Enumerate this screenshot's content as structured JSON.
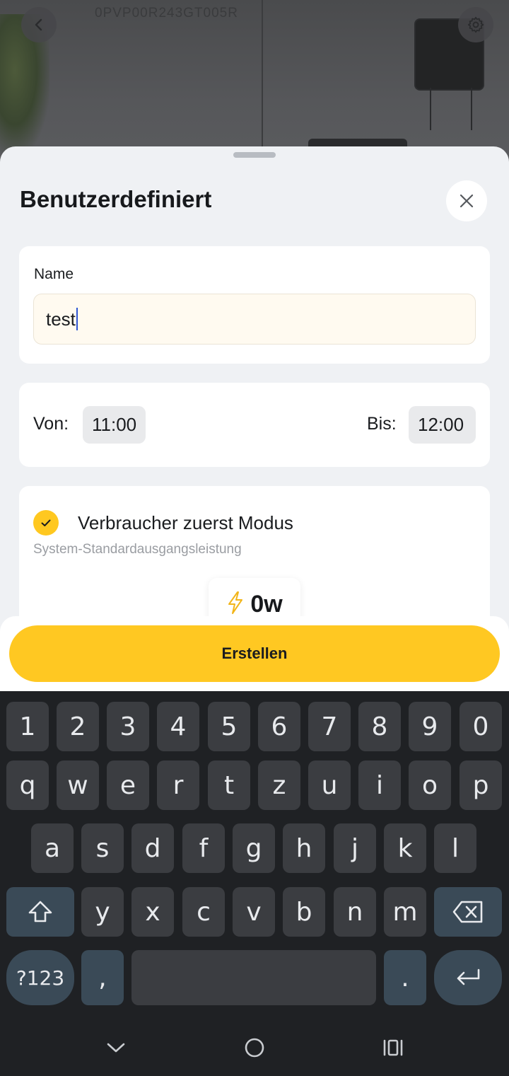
{
  "header": {
    "serial": "0PVP00R243GT005R",
    "back_icon": "chevron-left-icon",
    "settings_icon": "gear-icon"
  },
  "sheet": {
    "title": "Benutzerdefiniert",
    "close_icon": "close-icon"
  },
  "name_card": {
    "label": "Name",
    "value": "test"
  },
  "time_card": {
    "from_label": "Von:",
    "from_value": "11:00",
    "to_label": "Bis:",
    "to_value": "12:00"
  },
  "mode_card": {
    "title": "Verbraucher zuerst Modus",
    "subtitle": "System-Standardausgangsleistung",
    "selected": true,
    "power_value": "0w",
    "power_icon": "lightning-icon"
  },
  "create_button": {
    "label": "Erstellen"
  },
  "keyboard": {
    "row1": [
      "1",
      "2",
      "3",
      "4",
      "5",
      "6",
      "7",
      "8",
      "9",
      "0"
    ],
    "row2": [
      "q",
      "w",
      "e",
      "r",
      "t",
      "z",
      "u",
      "i",
      "o",
      "p"
    ],
    "row3": [
      "a",
      "s",
      "d",
      "f",
      "g",
      "h",
      "j",
      "k",
      "l"
    ],
    "row4": [
      "y",
      "x",
      "c",
      "v",
      "b",
      "n",
      "m"
    ],
    "symbols_label": "?123",
    "comma": ",",
    "period": "."
  },
  "colors": {
    "accent": "#ffc822",
    "sheet_bg": "#eff1f4",
    "keyboard_bg": "#1f2124"
  }
}
